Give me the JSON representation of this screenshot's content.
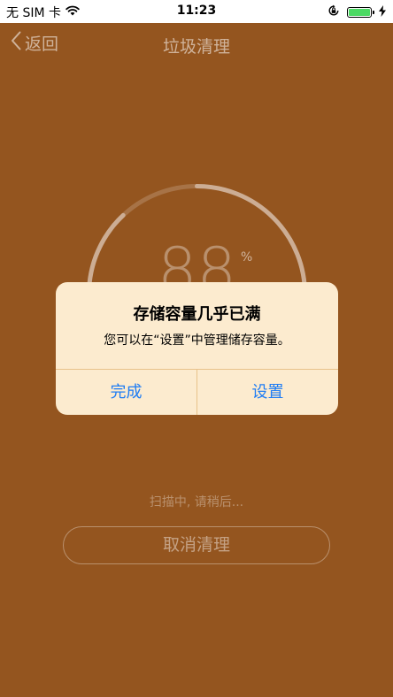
{
  "status_bar": {
    "carrier": "无 SIM 卡",
    "time": "11:23",
    "battery_level": 1.0,
    "battery_color": "#4cd964"
  },
  "nav": {
    "back_label": "返回",
    "title": "垃圾清理"
  },
  "scan": {
    "percent": "88",
    "percent_unit": "%",
    "progress": 0.88,
    "status_text": "扫描中, 请稍后...",
    "cancel_label": "取消清理"
  },
  "alert": {
    "title": "存储容量几乎已满",
    "message": "您可以在“设置”中管理储存容量。",
    "done_label": "完成",
    "settings_label": "设置"
  },
  "colors": {
    "background": "#94551f",
    "alert_background": "#fcebcf",
    "alert_button_text": "#1e7cf4"
  }
}
